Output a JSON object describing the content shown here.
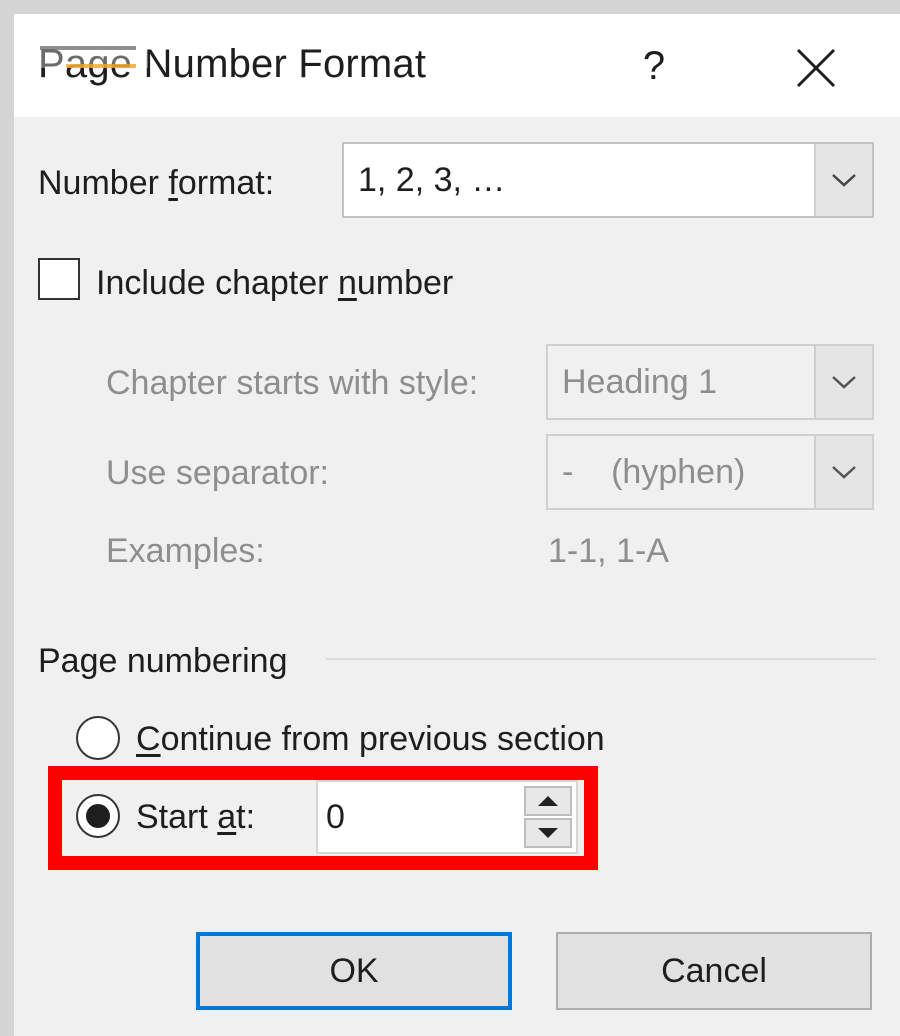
{
  "dialog": {
    "title": "Page Number Format",
    "help_label": "?",
    "close_icon": "close-icon"
  },
  "number_format": {
    "label_pre": "Number ",
    "label_key": "f",
    "label_post": "ormat:",
    "value": "1, 2, 3, …"
  },
  "chapter": {
    "checkbox_pre": "Include chapter ",
    "checkbox_key": "n",
    "checkbox_post": "umber",
    "checked": false,
    "style_label": "Chapter starts with style:",
    "style_value": "Heading 1",
    "separator_label": "Use separator:",
    "separator_value": "-    (hyphen)",
    "examples_label": "Examples:",
    "examples_value": "1-1, 1-A"
  },
  "page_numbering": {
    "group_label": "Page numbering",
    "continue_key": "C",
    "continue_post": "ontinue from previous section",
    "start_pre": "Start ",
    "start_key": "a",
    "start_post": "t:",
    "start_value": "0",
    "selected": "start_at"
  },
  "buttons": {
    "ok": "OK",
    "cancel": "Cancel"
  },
  "colors": {
    "highlight": "#ff0000",
    "ok_border": "#0078d7"
  },
  "icons": [
    "help-icon",
    "close-icon",
    "chevron-down-icon",
    "spin-up-icon",
    "spin-down-icon",
    "watermark-logo-icon"
  ]
}
